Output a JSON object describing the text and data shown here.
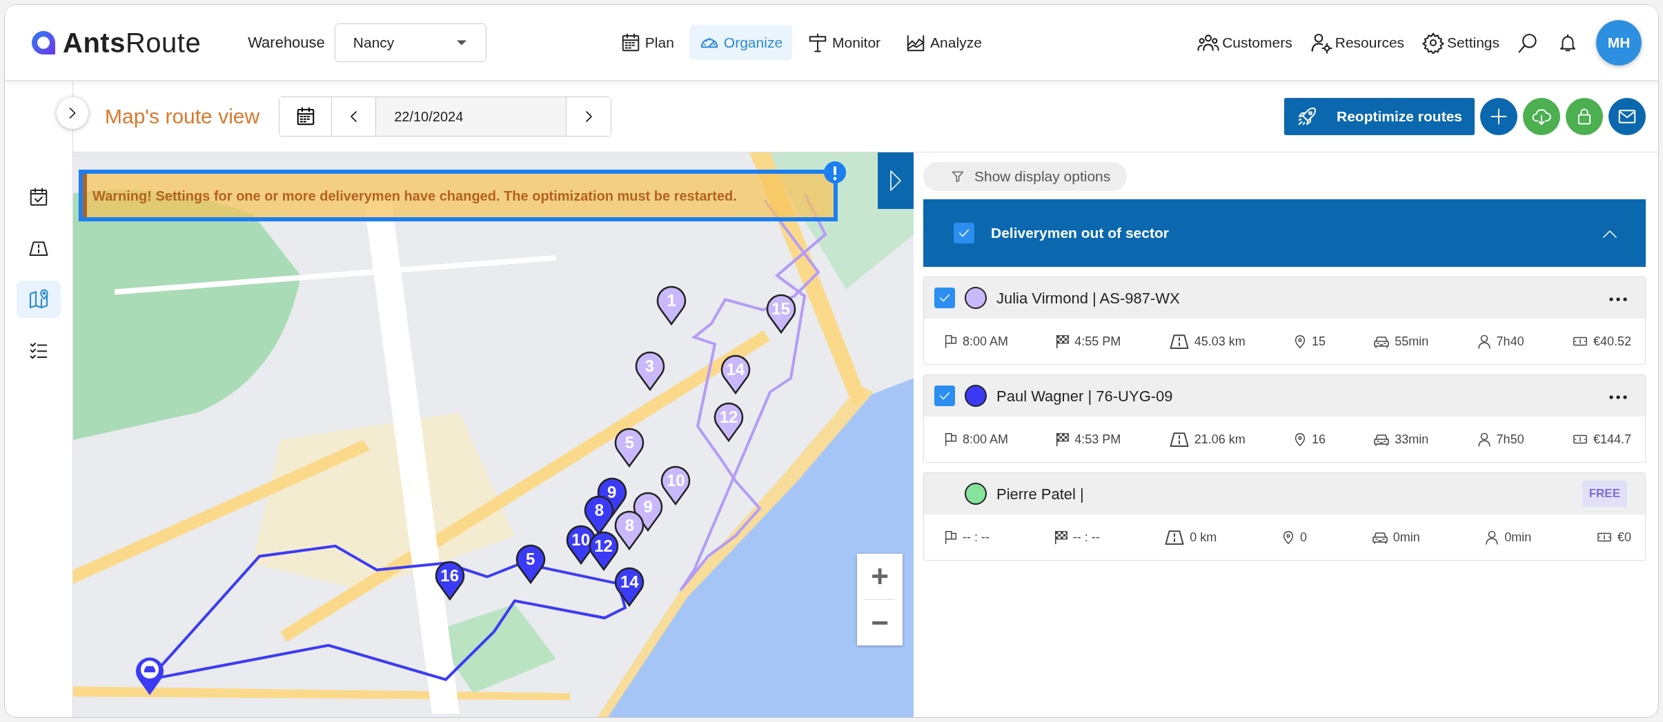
{
  "header": {
    "logo": "**Ants**Route",
    "warehouse_label": "Warehouse",
    "warehouse_value": "Nancy",
    "nav": [
      {
        "label": "Plan",
        "selected": false
      },
      {
        "label": "Organize",
        "selected": true
      },
      {
        "label": "Monitor",
        "selected": false
      },
      {
        "label": "Analyze",
        "selected": false
      }
    ],
    "actions": [
      {
        "label": "Customers"
      },
      {
        "label": "Resources"
      },
      {
        "label": "Settings"
      }
    ],
    "avatar": "MH"
  },
  "sidebar": {
    "items": [
      {
        "selected": false
      },
      {
        "selected": false
      },
      {
        "selected": true
      },
      {
        "selected": false
      }
    ]
  },
  "toolbar": {
    "title": "Map's route view",
    "date": "22/10/2024",
    "reoptimize": "Reoptimize routes"
  },
  "map": {
    "warning": "Warning! Settings for one or more deliverymen have changed. The optimization must be restarted.",
    "zoom_in": "+",
    "zoom_out": "−",
    "markers": [
      {
        "label": "1",
        "color": "#c9b8fa"
      },
      {
        "label": "15",
        "color": "#c9b8fa"
      },
      {
        "label": "3",
        "color": "#c9b8fa"
      },
      {
        "label": "14",
        "color": "#c9b8fa"
      },
      {
        "label": "12",
        "color": "#c9b8fa"
      },
      {
        "label": "5",
        "color": "#c9b8fa"
      },
      {
        "label": "10",
        "color": "#c9b8fa"
      },
      {
        "label": "9",
        "color": "#c9b8fa"
      },
      {
        "label": "8",
        "color": "#c9b8fa"
      },
      {
        "label": "9",
        "color": "#3b3bf5"
      },
      {
        "label": "8",
        "color": "#3b3bf5"
      },
      {
        "label": "10",
        "color": "#3b3bf5"
      },
      {
        "label": "12",
        "color": "#3b3bf5"
      },
      {
        "label": "5",
        "color": "#3b3bf5"
      },
      {
        "label": "16",
        "color": "#3b3bf5"
      },
      {
        "label": "14",
        "color": "#3b3bf5"
      }
    ]
  },
  "panel": {
    "display_options": "Show display options",
    "group": {
      "title": "Deliverymen out of sector",
      "checked": true,
      "expanded": true
    },
    "drivers": [
      {
        "name": "Julia Virmond | AS-987-WX",
        "color": "#c9b8fa",
        "checked": true,
        "stats": [
          "8:00 AM",
          "4:55 PM",
          "45.03 km",
          "15",
          "55min",
          "7h40",
          "€40.52"
        ]
      },
      {
        "name": "Paul Wagner | 76-UYG-09",
        "color": "#3b3bf5",
        "checked": true,
        "stats": [
          "8:00 AM",
          "4:53 PM",
          "21.06 km",
          "16",
          "33min",
          "7h50",
          "€144.7"
        ]
      },
      {
        "name": "Pierre Patel |",
        "color": "#86e39b",
        "badge": "FREE",
        "stats": [
          "-- : --",
          "-- : --",
          "0 km",
          "0",
          "0min",
          "0min",
          "€0"
        ]
      }
    ]
  }
}
